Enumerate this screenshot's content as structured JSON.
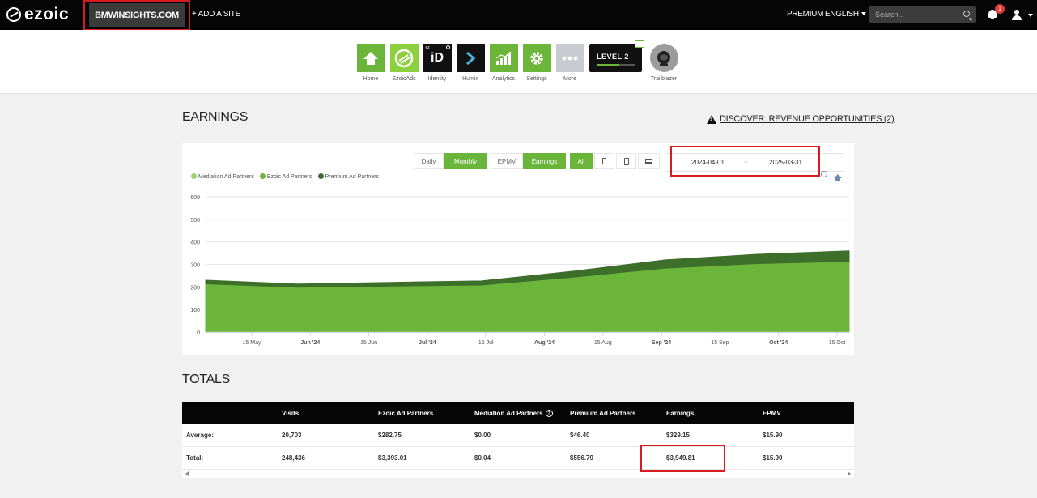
{
  "header": {
    "logo": "ezoic",
    "site": "BMWINSIGHTS.COM",
    "add_site": "+ ADD A SITE",
    "premium": "PREMIUM",
    "language": "ENGLISH",
    "search_placeholder": "Search...",
    "notifications": "1"
  },
  "nav": [
    {
      "label": "Home",
      "icon": "home-icon"
    },
    {
      "label": "EzoicAds",
      "icon": "ezoicads-icon"
    },
    {
      "label": "Identity",
      "icon": "identity-icon",
      "glyph": "iD",
      "superscript": "ez"
    },
    {
      "label": "Humix",
      "icon": "humix-icon"
    },
    {
      "label": "Analytics",
      "icon": "analytics-icon"
    },
    {
      "label": "Settings",
      "icon": "gear-icon"
    },
    {
      "label": "More",
      "icon": "more-icon"
    },
    {
      "label": "LEVEL 2",
      "icon": "level-badge-icon"
    },
    {
      "label": "Trailblazer",
      "icon": "astronaut-icon"
    }
  ],
  "earnings": {
    "title": "EARNINGS",
    "discover_link": "DISCOVER: REVENUE OPPORTUNITIES (2)",
    "controls": {
      "daily": "Daily",
      "monthly": "Monthly",
      "epmv": "EPMV",
      "earnings": "Earnings",
      "all": "All",
      "device_icons": [
        "tablet-icon",
        "mobile-icon",
        "desktop-icon"
      ]
    },
    "date_from": "2024-04-01",
    "date_sep": "~",
    "date_to": "2025-03-31",
    "colors": {
      "mediation": "#9ccf7a",
      "ezoic": "#6bb53a",
      "premium": "#3d6e2a",
      "accent": "#6bb53a"
    }
  },
  "chart_data": {
    "type": "area",
    "stacked": true,
    "legend": [
      "Mediation Ad Partners",
      "Ezoic Ad Partners",
      "Premium Ad Partners"
    ],
    "legend_position": "top-left",
    "ylim": [
      0,
      600
    ],
    "yticks": [
      0,
      100,
      200,
      300,
      400,
      500,
      600
    ],
    "xticks": [
      "15 May",
      "Jun '24",
      "15 Jun",
      "Jul '24",
      "15 Jul",
      "Aug '24",
      "15 Aug",
      "Sep '24",
      "15 Sep",
      "Oct '24",
      "15 Oct"
    ],
    "x": [
      "2024-04",
      "2024-05",
      "2024-06",
      "2024-07",
      "2024-08",
      "2024-09",
      "2024-10",
      "2024-11"
    ],
    "series": [
      {
        "name": "Mediation Ad Partners",
        "values": [
          0,
          0,
          0,
          0,
          0,
          0,
          0,
          0
        ]
      },
      {
        "name": "Ezoic Ad Partners",
        "values": [
          210,
          195,
          200,
          205,
          240,
          280,
          300,
          310
        ]
      },
      {
        "name": "Premium Ad Partners",
        "values": [
          20,
          18,
          20,
          22,
          30,
          40,
          45,
          50
        ]
      }
    ],
    "grid": true
  },
  "totals": {
    "title": "TOTALS",
    "columns": [
      "",
      "Visits",
      "Ezoic Ad Partners",
      "Mediation Ad Partners",
      "Premium Ad Partners",
      "Earnings",
      "EPMV"
    ],
    "rows": [
      [
        "Average:",
        "20,703",
        "$282.75",
        "$0.00",
        "$46.40",
        "$329.15",
        "$15.90"
      ],
      [
        "Total:",
        "248,436",
        "$3,393.01",
        "$0.04",
        "$556.79",
        "$3,949.81",
        "$15.90"
      ]
    ],
    "help_icon": "question-circle-icon"
  }
}
